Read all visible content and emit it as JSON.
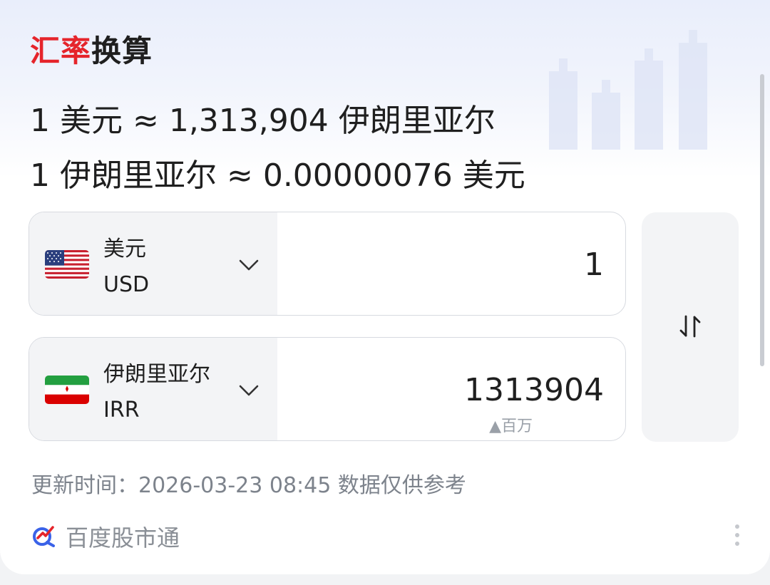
{
  "title": {
    "part1": "汇率",
    "part2": "换算"
  },
  "rate": {
    "line1": "1 美元 ≈ 1,313,904 伊朗里亚尔",
    "line2": "1 伊朗里亚尔 ≈ 0.00000076 美元"
  },
  "from": {
    "name": "美元",
    "code": "USD",
    "amount": "1",
    "flag_icon": "us-flag-icon"
  },
  "to": {
    "name": "伊朗里亚尔",
    "code": "IRR",
    "amount": "1313904",
    "unit_hint": "▲百万",
    "flag_icon": "iran-flag-icon"
  },
  "swap": {
    "icon": "swap-arrows-icon"
  },
  "update_text": "更新时间：2026-03-23 08:45 数据仅供参考",
  "source": {
    "label": "百度股市通",
    "icon": "baidu-stock-logo-icon"
  },
  "colors": {
    "title_red": "#e5242b",
    "text": "#1f1f1f",
    "muted": "#7d838c",
    "panel": "#f3f4f6",
    "border": "#d7dae0"
  }
}
